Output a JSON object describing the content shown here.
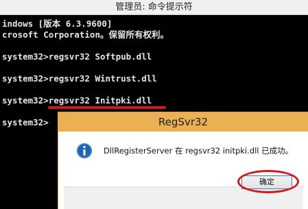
{
  "window": {
    "title": "管理员: 命令提示符"
  },
  "console": {
    "lines": [
      "indows [版本 6.3.9600]",
      "crosoft Corporation。保留所有权利。",
      "system32>regsvr32 Softpub.dll",
      "system32>regsvr32 Wintrust.dll",
      "system32>regsvr32 Initpki.dll",
      "system32>"
    ],
    "highlighted_command": "regsvr32 Initpki.dll",
    "colors": {
      "background": "#000000",
      "text": "#e6e6e6",
      "annotation": "#d61616"
    }
  },
  "dialog": {
    "title": "RegSvr32",
    "icon": "info-icon",
    "message": "DllRegisterServer 在 regsvr32 initpki.dll 已成功。",
    "ok_label": "确定",
    "colors": {
      "titlebar": "#ecb054",
      "icon": "#1c66b3"
    }
  }
}
